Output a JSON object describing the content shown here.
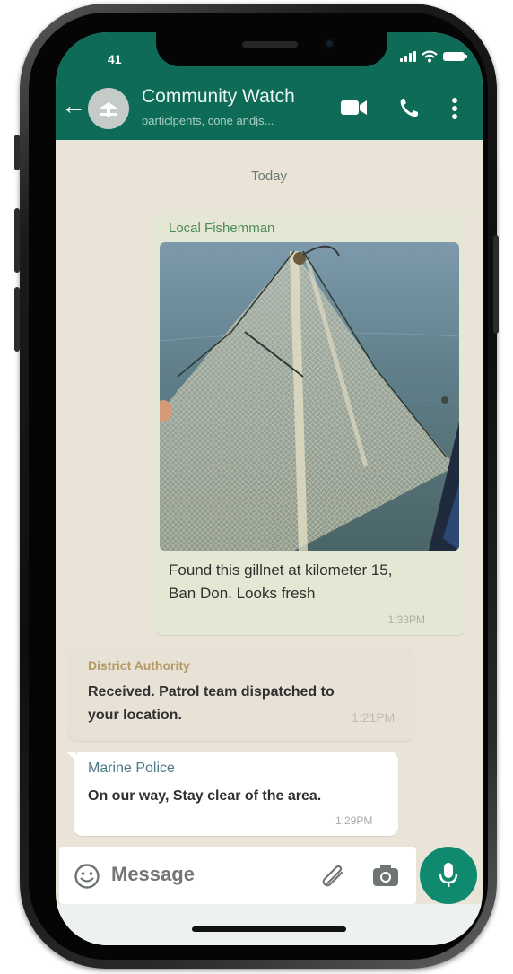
{
  "status_bar": {
    "time": "41"
  },
  "header": {
    "back_icon": "arrow-left-icon",
    "title": "Community Watch",
    "subtitle": "particlpents, cone andjs...",
    "icons": [
      "video-call-icon",
      "voice-call-icon",
      "more-options-icon"
    ]
  },
  "chat": {
    "date_label": "Today",
    "messages": [
      {
        "sender": "Local Fishemman",
        "text_line1": "Found this gillnet at kilometer 15,",
        "text_line2": "Ban Don. Looks fresh",
        "time": "1:33PM",
        "sender_color": "#4f8a5a",
        "attachment": "photo of gillnet in water"
      },
      {
        "sender": "District Authority",
        "text_line1": "Received. Patrol team dispatched to",
        "text_line2": "your location.",
        "time": "1:21PM",
        "sender_color": "#b49a62"
      },
      {
        "sender": "Marine Police",
        "text_line1": "On our way, Stay clear of the area.",
        "time": "1:29PM",
        "sender_color": "#4b7a86"
      }
    ]
  },
  "composer": {
    "placeholder": "Message",
    "icons": [
      "emoji-icon",
      "attach-paperclip-icon",
      "camera-icon",
      "microphone-icon"
    ]
  },
  "colors": {
    "header": "#0e6b58",
    "outgoing_bubble": "#e5e7d4",
    "incoming_bubble": "#ffffff",
    "mic_button": "#0f8a6e",
    "chat_background": "#e9e3d8"
  }
}
